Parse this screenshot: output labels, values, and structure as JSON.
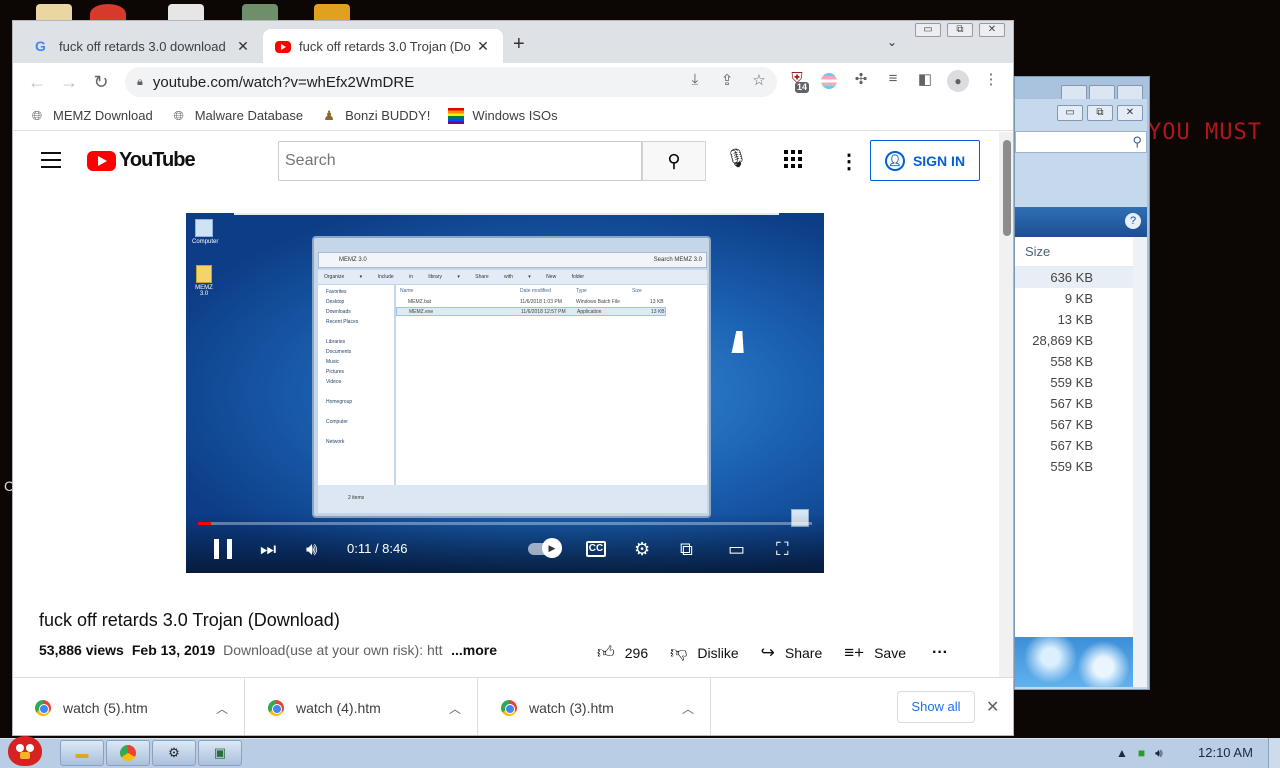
{
  "desktop": {
    "bg_text": "YOU MUST",
    "stray_char": "C"
  },
  "bg_window": {
    "size_header": "Size",
    "sizes": [
      "636 KB",
      "9 KB",
      "13 KB",
      "28,869 KB",
      "558 KB",
      "559 KB",
      "567 KB",
      "567 KB",
      "567 KB",
      "559 KB"
    ]
  },
  "browser": {
    "tabs": [
      {
        "title": "fuck off retards 3.0 download",
        "icon": "google-icon",
        "active": false
      },
      {
        "title": "fuck off retards 3.0 Trojan (Do",
        "icon": "youtube-icon",
        "active": true
      }
    ],
    "url": "youtube.com/watch?v=whEfx2WmDRE",
    "extension_badge": "14",
    "bookmarks": [
      {
        "label": "MEMZ Download",
        "icon": "globe-icon"
      },
      {
        "label": "Malware Database",
        "icon": "globe-icon"
      },
      {
        "label": "Bonzi BUDDY!",
        "icon": "bonzi-icon"
      },
      {
        "label": "Windows ISOs",
        "icon": "rainbow-flag-icon"
      }
    ]
  },
  "youtube": {
    "logo_text": "YouTube",
    "search_placeholder": "Search",
    "signin_label": "SIGN IN",
    "video": {
      "time": "0:11 / 8:46",
      "progress": 0.021,
      "inner_window_title": "MEMZ 3.0",
      "inner_search": "Search MEMZ 3.0",
      "inner_cmds": "Organize ▾ Include in library ▾ Share with ▾ New folder",
      "inner_nav": [
        "Favorites",
        "Desktop",
        "Downloads",
        "Recent Places",
        "",
        "Libraries",
        "Documents",
        "Music",
        "Pictures",
        "Videos",
        "",
        "Homegroup",
        "",
        "Computer",
        "",
        "Network"
      ],
      "inner_cols": [
        "Name",
        "Date modified",
        "Type",
        "Size"
      ],
      "inner_files": [
        {
          "name": "MEMZ.bat",
          "date": "11/6/2018 1:03 PM",
          "type": "Windows Batch File",
          "size": "13 KB"
        },
        {
          "name": "MEMZ.exe",
          "date": "11/6/2018 12:57 PM",
          "type": "Application",
          "size": "13 KB"
        }
      ],
      "inner_status": "2 items",
      "desk_icons": [
        "Computer",
        "MEMZ 3.0"
      ]
    },
    "title": "fuck off retards 3.0 Trojan (Download)",
    "views": "53,886 views",
    "date": "Feb 13, 2019",
    "desc_snippet": "Download(use at your own risk): htt",
    "more": "...more",
    "likes": "296",
    "dislike_label": "Dislike",
    "share_label": "Share",
    "save_label": "Save"
  },
  "downloads": {
    "items": [
      "watch (5).htm",
      "watch (4).htm",
      "watch (3).htm"
    ],
    "show_all": "Show all"
  },
  "taskbar": {
    "clock": "12:10 AM"
  }
}
